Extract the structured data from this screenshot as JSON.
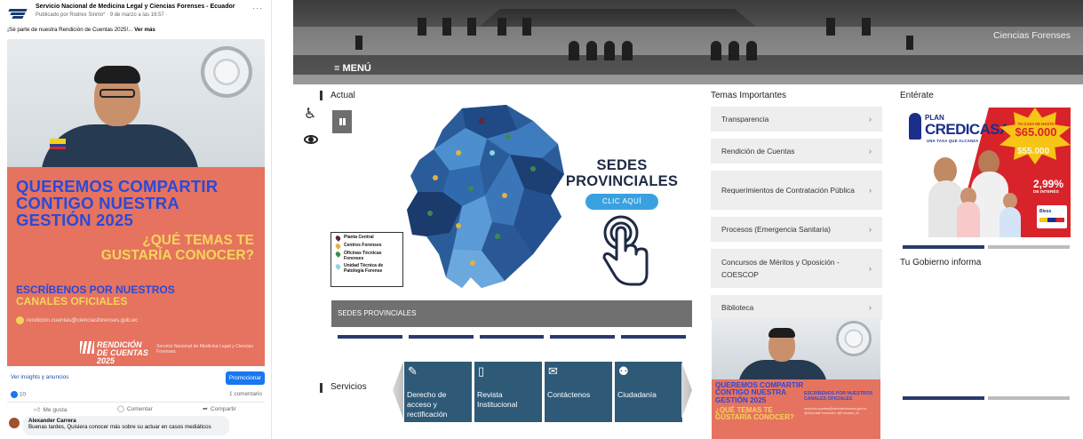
{
  "facebook": {
    "page_name": "Servicio Nacional de Medicina Legal y Ciencias Forenses - Ecuador",
    "meta": "Publicado por Rodrex Sinnlo* · 9 de marzo a las 16:57 ·",
    "more": "···",
    "caption_text": "¡Sé parte de nuestra Rendición de Cuentas 2025!... ",
    "caption_more": "Ver más",
    "poster": {
      "headline": "QUEREMOS COMPARTIR CONTIGO NUESTRA GESTIÓN 2025",
      "question": "¿QUÉ TEMAS TE GUSTARÍA CONOCER?",
      "channels_line1": "ESCRÍBENOS POR NUESTROS",
      "channels_line2": "CANALES OFICIALES",
      "email": "rendicion.cuentas@cienciasforenses.gob.ec",
      "logo": "RENDICIÓN DE CUENTAS 2025",
      "org": "Servicio Nacional de Medicina Legal y Ciencias Forenses"
    },
    "insights": "Ver insights y anuncios",
    "promote": "Promocionar",
    "reactions_count": "10",
    "comments_count": "1 comentario",
    "actions": {
      "like": "Me gusta",
      "comment": "Comentar",
      "share": "Compartir"
    },
    "comment": {
      "author": "Alexander Carrera",
      "text": "Buenas tardes, Quisiera conocer más sobre su actuar en casos mediáticos"
    }
  },
  "site": {
    "banner_title": "Ciencias Forenses",
    "menu_label": "≡ MENÚ",
    "actual_label": "Actual",
    "sedes": {
      "title_line1": "SEDES",
      "title_line2": "PROVINCIALES",
      "button": "CLIC AQUÍ",
      "strip_label": "SEDES PROVINCIALES",
      "legend": [
        {
          "label": "Planta Central",
          "color": "#5a2a3a"
        },
        {
          "label": "Centros Forenses",
          "color": "#e0b341"
        },
        {
          "label": "Oficinas Técnicas Forenses",
          "color": "#3d8a4f"
        },
        {
          "label": "Unidad Técnica de Patología Forense",
          "color": "#8fd3e8"
        }
      ]
    },
    "servicios_label": "Servicios",
    "services": [
      {
        "icon": "✎",
        "label": "Derecho de acceso y rectificación"
      },
      {
        "icon": "▯",
        "label": "Revista Institucional"
      },
      {
        "icon": "✉",
        "label": "Contáctenos"
      },
      {
        "icon": "⚉",
        "label": "Ciudadanía"
      }
    ],
    "temas_title": "Temas Importantes",
    "temas": [
      "Transparencia",
      "Rendición de Cuentas",
      "Requerimientos de Contratación Pública",
      "Procesos (Emergencia Sanitaria)",
      "Concursos de Méritos y Oposición - COESCOP",
      "Biblioteca"
    ],
    "chevron": "›",
    "mini_post": {
      "headline": "QUEREMOS COMPARTIR CONTIGO NUESTRA GESTIÓN 2025",
      "question": "¿QUÉ TEMAS TE GUSTARÍA CONOCER?",
      "channels": "ESCRÍBENOS POR NUESTROS CANALES OFICIALES",
      "links": "rendicion.cuentas@cienciasforenses.gob.ec @CienciasForensesEc @Forenses_Ec"
    },
    "enterate_title": "Entérate",
    "ad": {
      "plan": "PLAN",
      "brand": "CREDICASA",
      "tagline": "UNA TASA QUE ALCANZA",
      "star_small": "TU CASA DE HASTA",
      "star_big": "$65.000",
      "strike": "$55.000",
      "rate": "2,99%",
      "interest": "DE INTERÉS",
      "bank": "Biess"
    },
    "gobierno_title": "Tu Gobierno informa",
    "colors": {
      "navy": "#2a3a6e",
      "service_blue": "#2e5a78",
      "cta_blue": "#3aa1e0",
      "ad_red": "#d9232a",
      "dot_inactive": "#bdbdbd"
    }
  }
}
